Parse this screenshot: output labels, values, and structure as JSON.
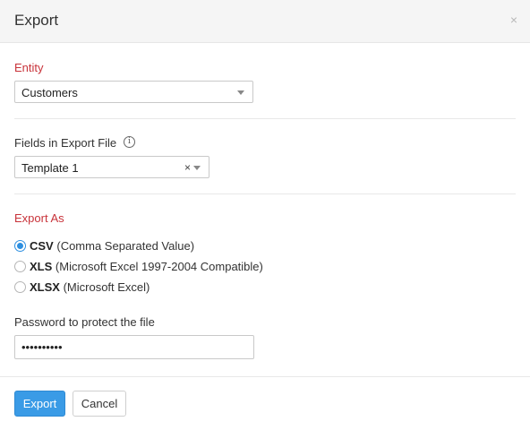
{
  "dialog": {
    "title": "Export",
    "close_glyph": "×"
  },
  "entity": {
    "label": "Entity",
    "selected": "Customers"
  },
  "fields": {
    "label": "Fields in Export File",
    "info_glyph": "i",
    "selected": "Template 1",
    "clear_glyph": "×"
  },
  "export_as": {
    "label": "Export As",
    "options": [
      {
        "format": "CSV",
        "description": "(Comma Separated Value)",
        "checked": true
      },
      {
        "format": "XLS",
        "description": "(Microsoft Excel 1997-2004 Compatible)",
        "checked": false
      },
      {
        "format": "XLSX",
        "description": "(Microsoft Excel)",
        "checked": false
      }
    ]
  },
  "password": {
    "label": "Password to protect the file",
    "value": "••••••••••"
  },
  "footer": {
    "export_label": "Export",
    "cancel_label": "Cancel"
  },
  "colors": {
    "accent": "#3a9be6",
    "section_label": "#c8333a"
  }
}
